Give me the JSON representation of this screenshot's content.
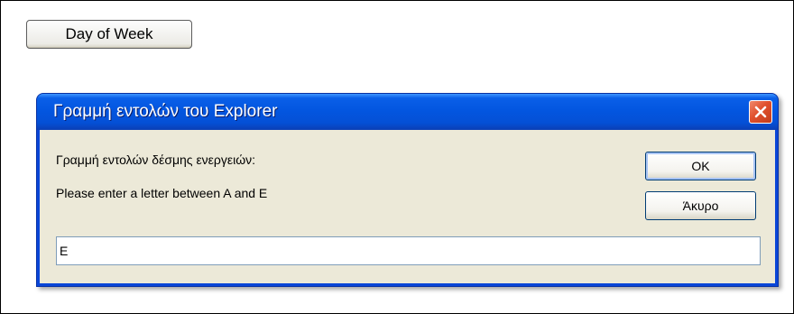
{
  "page": {
    "day_button_label": "Day of Week"
  },
  "dialog": {
    "title": "Γραμμή εντολών του Explorer",
    "prompt_label": "Γραμμή εντολών δέσμης ενεργειών:",
    "message": "Please enter a letter between A and E",
    "ok_label": "OK",
    "cancel_label": "Άκυρο",
    "input_value": "E",
    "close_icon": "close-icon"
  },
  "colors": {
    "titlebar": "#0356e0",
    "dialog_body": "#ece9d8",
    "close_button": "#e0502c"
  }
}
